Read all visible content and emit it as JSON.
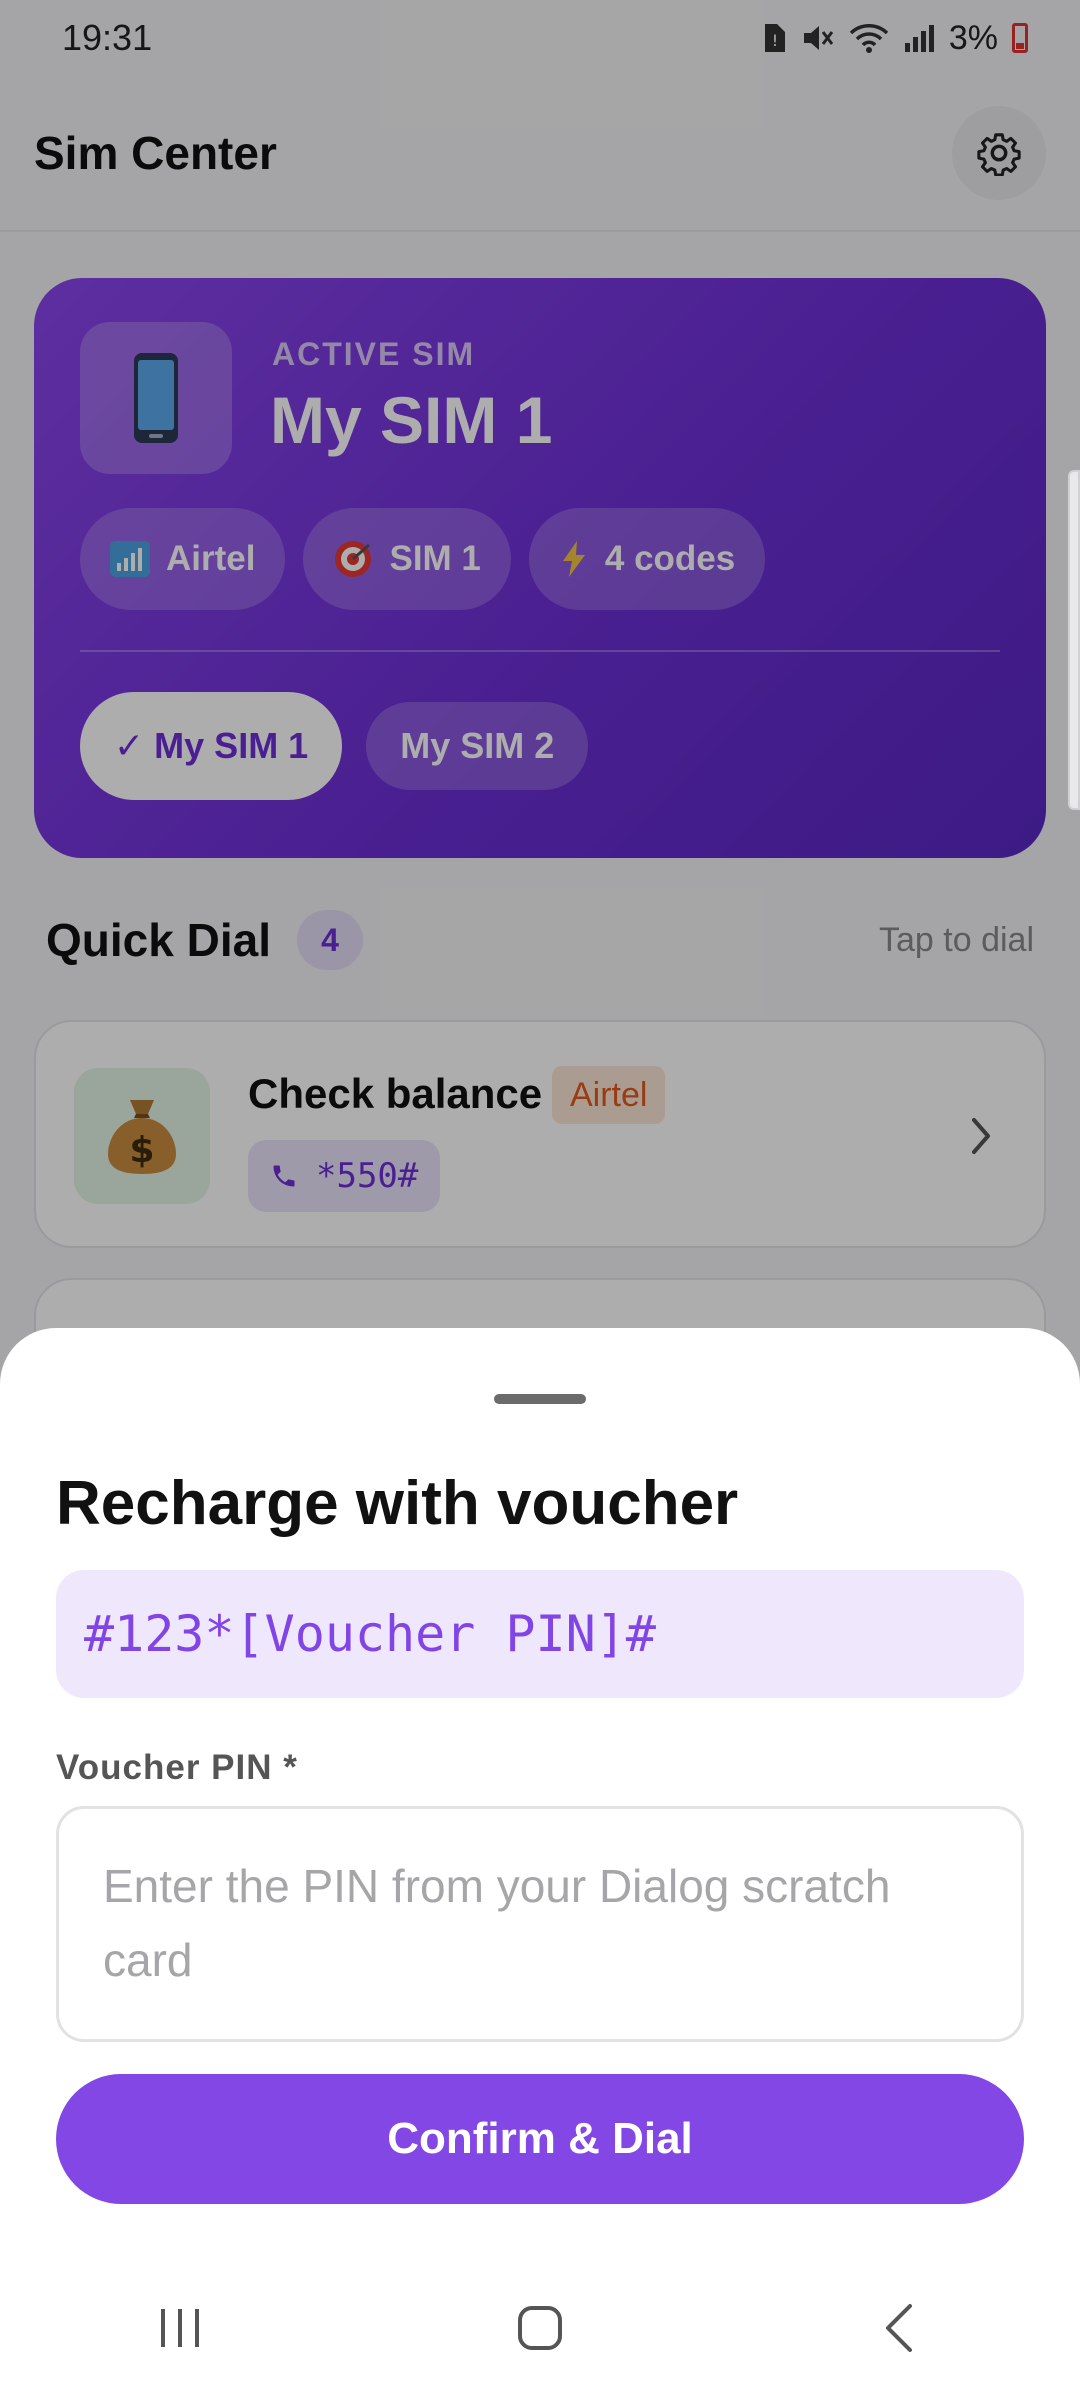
{
  "status_bar": {
    "time": "19:31",
    "battery": "3%"
  },
  "app": {
    "title": "Sim Center"
  },
  "sim_card": {
    "label": "ACTIVE SIM",
    "name": "My SIM 1",
    "chips": [
      {
        "icon": "signal-icon",
        "label": "Airtel"
      },
      {
        "icon": "target-icon",
        "label": "SIM 1"
      },
      {
        "icon": "lightning-icon",
        "label": "4 codes"
      }
    ],
    "tabs": [
      {
        "label": "✓ My SIM 1",
        "active": true
      },
      {
        "label": "My SIM 2",
        "active": false
      }
    ]
  },
  "quick_dial": {
    "title": "Quick Dial",
    "count": "4",
    "hint": "Tap to dial",
    "items": [
      {
        "name": "Check balance",
        "carrier": "Airtel",
        "code": "*550#",
        "icon": "money-bag-icon"
      }
    ]
  },
  "sheet": {
    "title": "Recharge with voucher",
    "code_template": "#123*[Voucher PIN]#",
    "pin_label": "Voucher PIN *",
    "pin_placeholder": "Enter the PIN from your Dialog scratch card",
    "pin_value": "",
    "confirm_label": "Confirm & Dial"
  },
  "colors": {
    "accent": "#8247e5",
    "sim_card_gradient_start": "#8a45ec",
    "sim_card_gradient_end": "#5a28c4",
    "carrier_badge": "#e0591c"
  }
}
